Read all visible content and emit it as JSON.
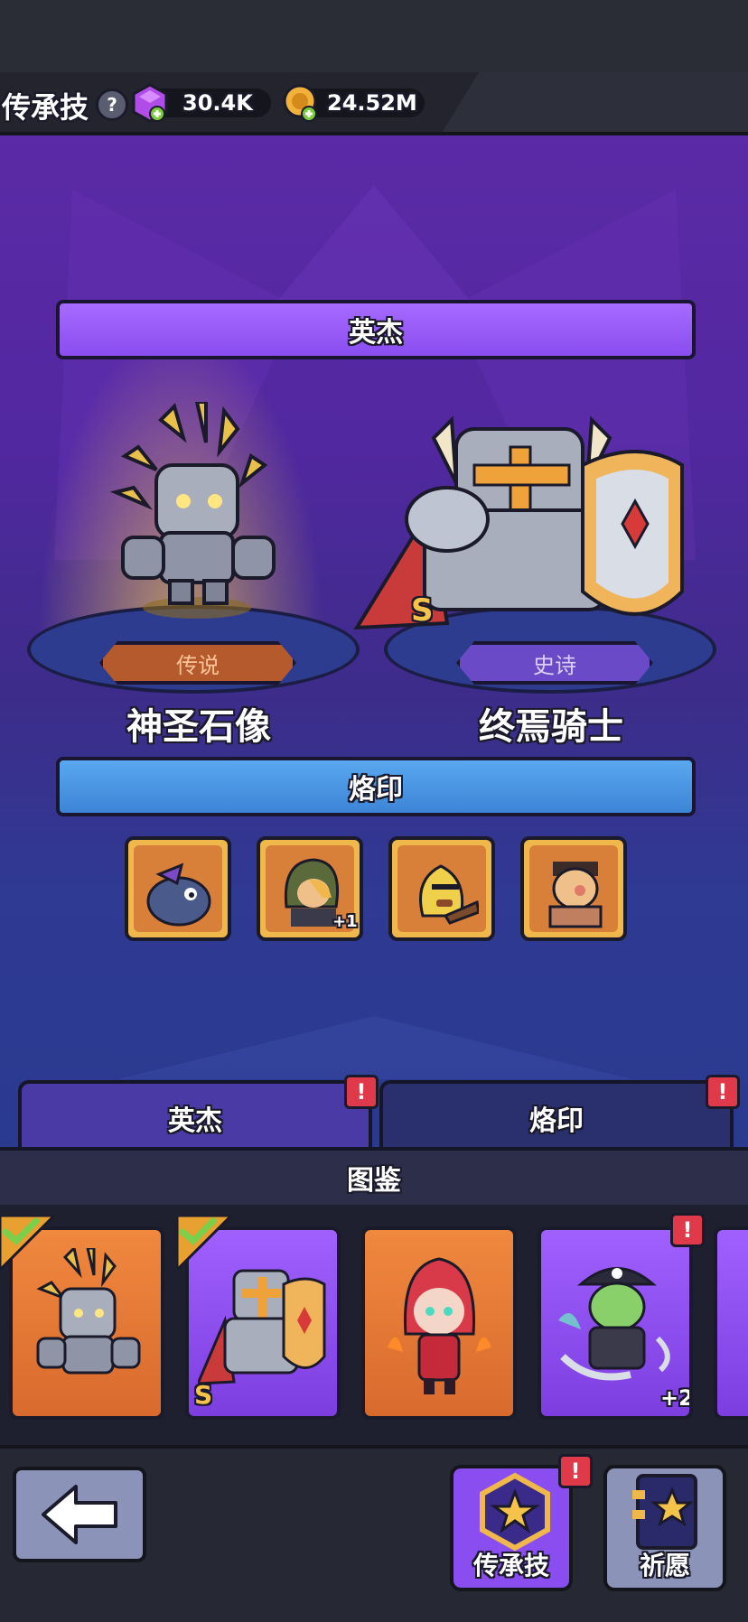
{
  "header": {
    "title": "传承技",
    "help_icon": "question-mark-icon",
    "gems": "30.4K",
    "coins": "24.52M"
  },
  "showcase": {
    "section_title": "英杰",
    "left_hero": {
      "name": "神圣石像",
      "rarity": "传说"
    },
    "right_hero": {
      "name": "终焉骑士",
      "rarity": "史诗",
      "grade": "S"
    },
    "imprint_title": "烙印",
    "imprints": [
      {
        "icon": "fish-monster-icon",
        "badge": ""
      },
      {
        "icon": "hooded-archer-icon",
        "badge": "+1"
      },
      {
        "icon": "banana-warrior-icon",
        "badge": ""
      },
      {
        "icon": "bearded-brute-icon",
        "badge": ""
      }
    ]
  },
  "tabs": [
    {
      "label": "英杰",
      "alert": "!"
    },
    {
      "label": "烙印",
      "alert": "!"
    }
  ],
  "codex": {
    "title": "图鉴",
    "cards": [
      {
        "icon": "stone-golem-icon",
        "checked": true,
        "grade": "",
        "badge": "",
        "alert": false
      },
      {
        "icon": "armored-knight-icon",
        "checked": true,
        "grade": "S",
        "badge": "",
        "alert": false
      },
      {
        "icon": "fire-mage-girl-icon",
        "checked": false,
        "grade": "",
        "badge": "",
        "alert": false
      },
      {
        "icon": "ghost-pirate-icon",
        "checked": false,
        "grade": "",
        "badge": "+2",
        "alert": true
      }
    ]
  },
  "nav": {
    "back_icon": "back-arrow-icon",
    "legacy_label": "传承技",
    "legacy_alert": "!",
    "wish_label": "祈愿"
  },
  "colors": {
    "legend": "#b55a2c",
    "epic": "#6b4ac8",
    "heroes_banner": "#9b5cff",
    "imprint_banner": "#4a98e6",
    "alert": "#e03a4a"
  }
}
